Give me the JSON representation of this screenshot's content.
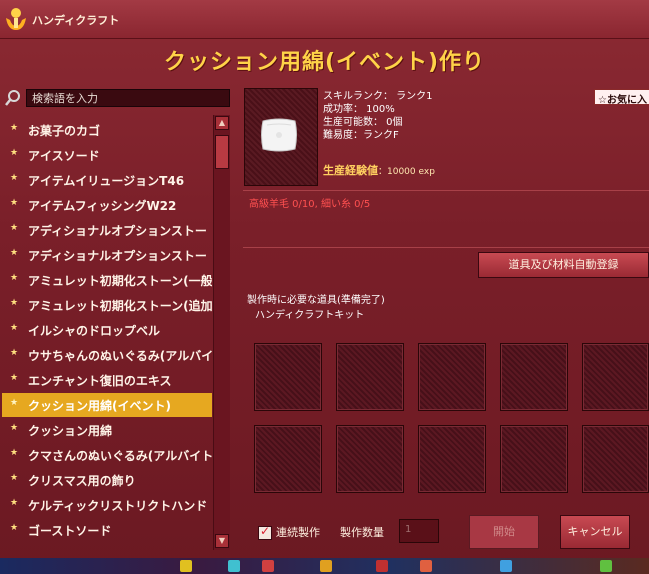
{
  "app": {
    "title": "ハンディクラフト"
  },
  "heading": "クッション用綿(イベント)作り",
  "search": {
    "placeholder": "検索語を入力"
  },
  "recipes": [
    {
      "label": "お菓子のカゴ",
      "selected": false
    },
    {
      "label": "アイスソード",
      "selected": false
    },
    {
      "label": "アイテムイリュージョンT46",
      "selected": false
    },
    {
      "label": "アイテムフィッシングW22",
      "selected": false
    },
    {
      "label": "アディショナルオプションストー",
      "selected": false
    },
    {
      "label": "アディショナルオプションストー",
      "selected": false
    },
    {
      "label": "アミュレット初期化ストーン(一般",
      "selected": false
    },
    {
      "label": "アミュレット初期化ストーン(追加",
      "selected": false
    },
    {
      "label": "イルシャのドロップベル",
      "selected": false
    },
    {
      "label": "ウサちゃんのぬいぐるみ(アルバイ",
      "selected": false
    },
    {
      "label": "エンチャント復旧のエキス",
      "selected": false
    },
    {
      "label": "クッション用綿(イベント)",
      "selected": true
    },
    {
      "label": "クッション用綿",
      "selected": false
    },
    {
      "label": "クマさんのぬいぐるみ(アルバイト",
      "selected": false
    },
    {
      "label": "クリスマス用の飾り",
      "selected": false
    },
    {
      "label": "ケルティックリストリクトハンド",
      "selected": false
    },
    {
      "label": "ゴーストソード",
      "selected": false
    }
  ],
  "details": {
    "skill_rank": "スキルランク： ランク1",
    "success_rate": "成功率： 100%",
    "craftable_count": "生産可能数： 0個",
    "difficulty": "難易度：ランクF",
    "exp_label": "生産経験値",
    "exp_value": "：10000 exp",
    "favorite": "☆お気に入"
  },
  "materials": {
    "text": "高級羊毛 0/10, 細い糸 0/5"
  },
  "buttons": {
    "auto_register": "道具及び材料自動登録",
    "start": "開始",
    "cancel": "キャンセル"
  },
  "tools": {
    "heading": "製作時に必要な道具(準備完了)",
    "item": "ハンディクラフトキット"
  },
  "footer": {
    "continuous_label": "連続製作",
    "continuous_checked": true,
    "quantity_label": "製作数量",
    "quantity_value": "1"
  },
  "colors": {
    "accent_gold": "#ffd348",
    "selected_bg": "#e6a820",
    "window_bg": "#7a1f29",
    "material_missing": "#ff5050"
  }
}
